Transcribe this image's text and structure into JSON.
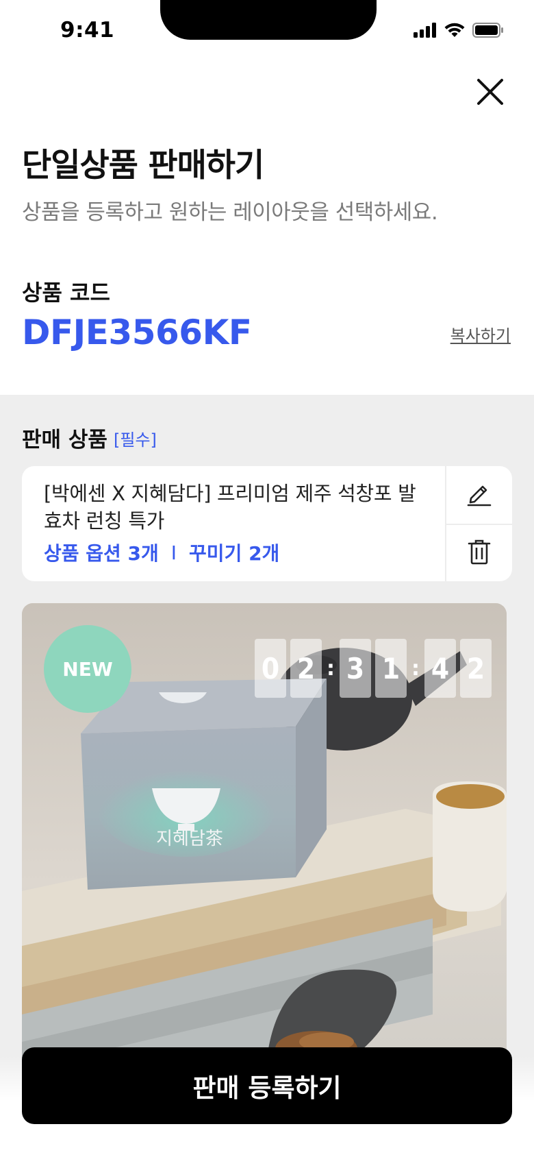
{
  "status_bar": {
    "time": "9:41",
    "icons": [
      "signal-icon",
      "wifi-icon",
      "battery-icon"
    ]
  },
  "header": {
    "close_icon": "close-icon",
    "title": "단일상품 판매하기",
    "subtitle": "상품을 등록하고 원하는 레이아웃을 선택하세요."
  },
  "product_code": {
    "label": "상품 코드",
    "value": "DFJE3566KF",
    "copy_label": "복사하기"
  },
  "sale_product": {
    "label": "판매 상품",
    "required_tag": "[필수]",
    "card": {
      "name": "[박에센 X 지혜담다] 프리미엄 제주 석창포 발효차 런칭 특가",
      "options": "상품 옵션 3개",
      "divider": "I",
      "decorations": "꾸미기 2개",
      "edit_icon": "pencil-icon",
      "delete_icon": "trash-icon"
    }
  },
  "preview": {
    "badge": "NEW",
    "countdown": {
      "h1": "0",
      "h2": "2",
      "m1": "3",
      "m2": "1",
      "s1": "4",
      "s2": "2",
      "separator": ":"
    },
    "box_brand": "지혜담茶"
  },
  "footer": {
    "submit_label": "판매 등록하기"
  },
  "colors": {
    "accent": "#3759ec",
    "badge": "#8ed6bd",
    "section_bg": "#eeeeee",
    "button": "#000000"
  }
}
